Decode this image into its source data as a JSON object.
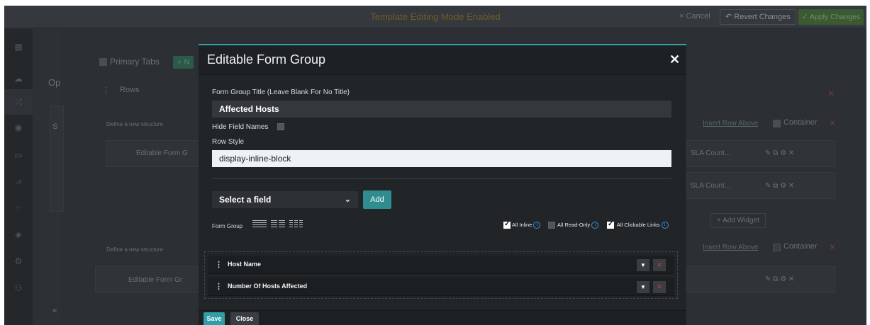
{
  "topbar": {
    "mode_text": "Template Editing Mode Enabled",
    "cancel_label": "× Cancel",
    "revert_label": "↶ Revert Changes",
    "apply_label": "✓ Apply Changes"
  },
  "background": {
    "primary_tabs_label": "Primary Tabs",
    "new_label": "+ N",
    "op_label": "Op",
    "rows_label": "Rows",
    "define_structure_1": "Define a new structure",
    "define_structure_2": "Define a new structure",
    "s_label": "S",
    "editable_form_1": "Editable Form G",
    "editable_form_2": "Editable Form Gr",
    "insert_row_above_1": "Insert Row Above",
    "insert_row_above_2": "Insert Row Above",
    "container_label_1": "Container",
    "container_label_2": "Container",
    "sla_count_1": "SLA Count...",
    "sla_count_2": "SLA Count...",
    "add_widget_label": "+ Add Widget",
    "collapse_label": "«"
  },
  "modal": {
    "title": "Editable Form Group",
    "form_group_title_label": "Form Group Title (Leave Blank For No Title)",
    "form_group_title_value": "Affected Hosts",
    "hide_field_names_label": "Hide Field Names",
    "row_style_label": "Row Style",
    "row_style_value": "display-inline-block",
    "select_field_value": "Select a field",
    "add_label": "Add",
    "form_group_label": "Form Group",
    "all_inline_label": "All Inline",
    "all_read_only_label": "All Read-Only",
    "all_clickable_links_label": "All Clickable Links",
    "info_glyph": "i",
    "fields": [
      {
        "name": "Host Name"
      },
      {
        "name": "Number Of Hosts Affected"
      }
    ],
    "save_label": "Save",
    "close_label": "Close",
    "close_icon": "✕"
  }
}
